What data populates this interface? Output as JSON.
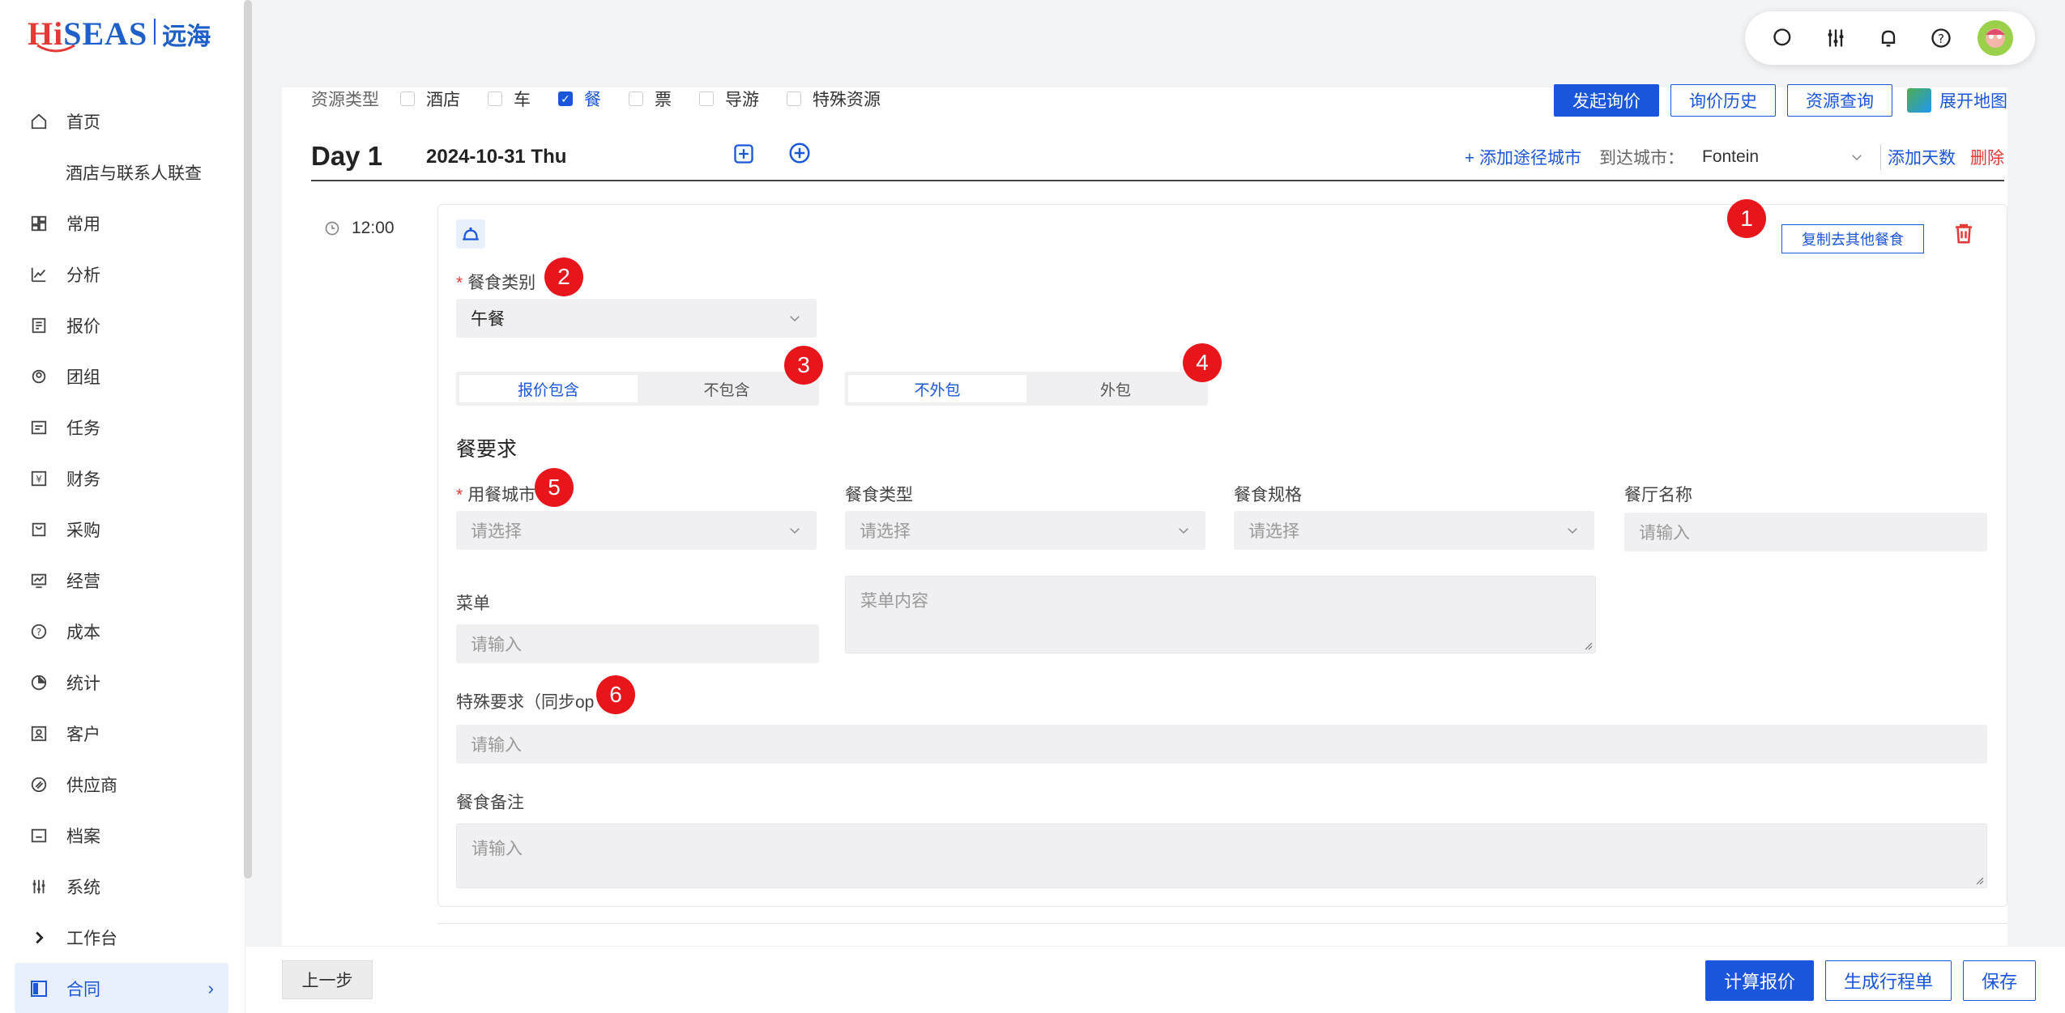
{
  "logo": {
    "brand_a": "Hi",
    "brand_b": "SEAS",
    "cn": "远海"
  },
  "sidebar": {
    "items": [
      {
        "label": "首页",
        "icon": "home-icon"
      },
      {
        "label": "酒店与联系人联查",
        "icon": ""
      },
      {
        "label": "常用",
        "icon": "grid-icon"
      },
      {
        "label": "分析",
        "icon": "trend-icon"
      },
      {
        "label": "报价",
        "icon": "doc-icon"
      },
      {
        "label": "团组",
        "icon": "group-icon"
      },
      {
        "label": "任务",
        "icon": "task-icon"
      },
      {
        "label": "财务",
        "icon": "yen-icon"
      },
      {
        "label": "采购",
        "icon": "bag-icon"
      },
      {
        "label": "经营",
        "icon": "monitor-icon"
      },
      {
        "label": "成本",
        "icon": "question-icon"
      },
      {
        "label": "统计",
        "icon": "pie-icon"
      },
      {
        "label": "客户",
        "icon": "contact-icon"
      },
      {
        "label": "供应商",
        "icon": "supplier-icon"
      },
      {
        "label": "档案",
        "icon": "folder-icon"
      },
      {
        "label": "系统",
        "icon": "sliders-icon"
      },
      {
        "label": "工作台",
        "icon": "chevron-right-icon"
      },
      {
        "label": "合同",
        "icon": "contract-icon"
      }
    ]
  },
  "toolbar": {
    "icons": [
      "search-icon",
      "settings-sliders-icon",
      "bell-icon",
      "help-icon",
      "avatar"
    ]
  },
  "resource_types": {
    "label": "资源类型",
    "options": [
      {
        "label": "酒店",
        "checked": false
      },
      {
        "label": "车",
        "checked": false
      },
      {
        "label": "餐",
        "checked": true
      },
      {
        "label": "票",
        "checked": false
      },
      {
        "label": "导游",
        "checked": false
      },
      {
        "label": "特殊资源",
        "checked": false
      }
    ]
  },
  "top_actions": {
    "inquiry": "发起询价",
    "history": "询价历史",
    "resource_query": "资源查询",
    "map": "展开地图"
  },
  "day": {
    "label": "Day 1",
    "date": "2024-10-31 Thu",
    "add_city": "+ 添加途径城市",
    "arrive_label": "到达城市：",
    "arrive_value": "Fontein",
    "add_days": "添加天数",
    "delete": "删除"
  },
  "meal": {
    "time": "12:00",
    "copy_button": "复制去其他餐食",
    "category_label": "餐食类别",
    "category_value": "午餐",
    "seg1": [
      "报价包含",
      "不包含"
    ],
    "seg2": [
      "不外包",
      "外包"
    ],
    "section_title": "餐要求",
    "city_label": "用餐城市",
    "city_placeholder": "请选择",
    "type_label": "餐食类型",
    "type_placeholder": "请选择",
    "spec_label": "餐食规格",
    "spec_placeholder": "请选择",
    "restaurant_label": "餐厅名称",
    "restaurant_placeholder": "请输入",
    "menu_label": "菜单",
    "menu_placeholder": "请输入",
    "menu_content_placeholder": "菜单内容",
    "special_label": "特殊要求（同步op",
    "special_placeholder": "请输入",
    "remark_label": "餐食备注",
    "remark_placeholder": "请输入"
  },
  "markers": [
    "1",
    "2",
    "3",
    "4",
    "5",
    "6"
  ],
  "bottom": {
    "prev": "上一步",
    "calc": "计算报价",
    "itinerary": "生成行程单",
    "save": "保存"
  },
  "colors": {
    "primary": "#1a56db",
    "danger": "#e53935",
    "marker": "#e8151b"
  }
}
